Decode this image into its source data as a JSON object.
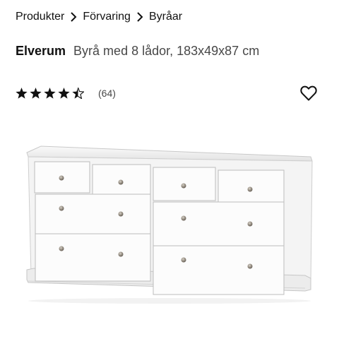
{
  "breadcrumb": {
    "items": [
      "Produkter",
      "Förvaring",
      "Byråar"
    ],
    "separator_icon": "chevron-right-icon"
  },
  "product": {
    "name": "Elverum",
    "description": "Byrå med 8 lådor, 183x49x87 cm",
    "rating_value": 4.5,
    "rating_max": 5,
    "review_count": "(64)",
    "favorite_icon": "heart-outline-icon",
    "image": {
      "subject": "white chest of drawers with 8 drawers and round metal knobs",
      "drawers": 8,
      "color": "#ffffff"
    }
  },
  "colors": {
    "text": "#111111",
    "secondary_text": "#484848",
    "background": "#ffffff"
  }
}
